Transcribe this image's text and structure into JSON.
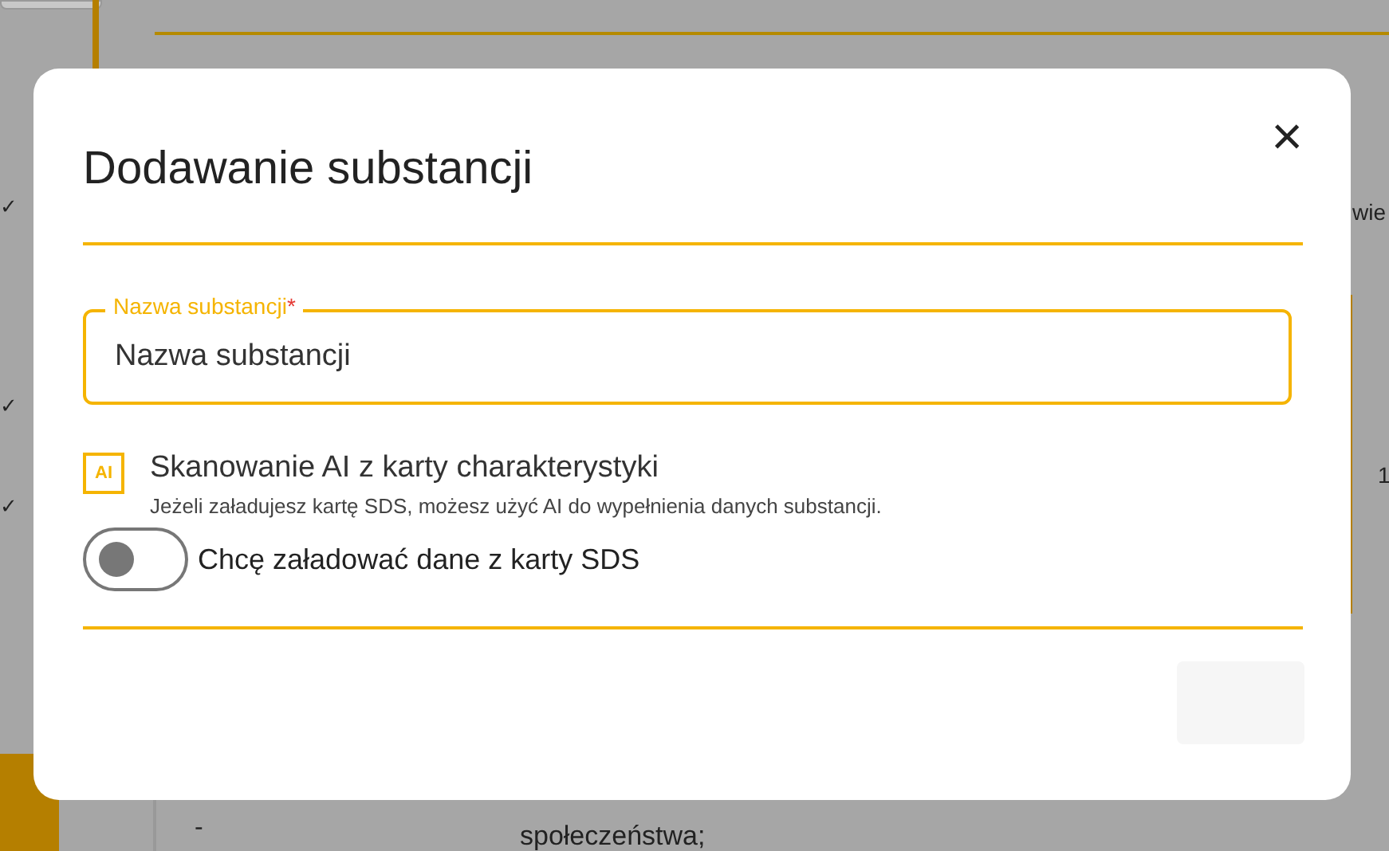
{
  "background": {
    "marks": [
      "✓",
      "✓",
      "✓"
    ],
    "header_fragment": "wie",
    "cell_fragment": "1",
    "table_text": [
      "-",
      "społeczeństwa;"
    ]
  },
  "dialog": {
    "title": "Dodawanie substancji",
    "close": "×",
    "name_field": {
      "label": "Nazwa substancji",
      "required_mark": "*",
      "placeholder": "Nazwa substancji",
      "focused": true
    },
    "ai_section": {
      "badge": "AI",
      "title": "Skanowanie AI z karty charakterystyki",
      "description": "Jeżeli załadujesz kartę SDS, możesz użyć AI do wypełnienia danych substancji."
    },
    "sds_toggle": {
      "label": "Chcę załadować dane z karty SDS",
      "on": false
    },
    "footer_button": {
      "disabled": true
    }
  }
}
